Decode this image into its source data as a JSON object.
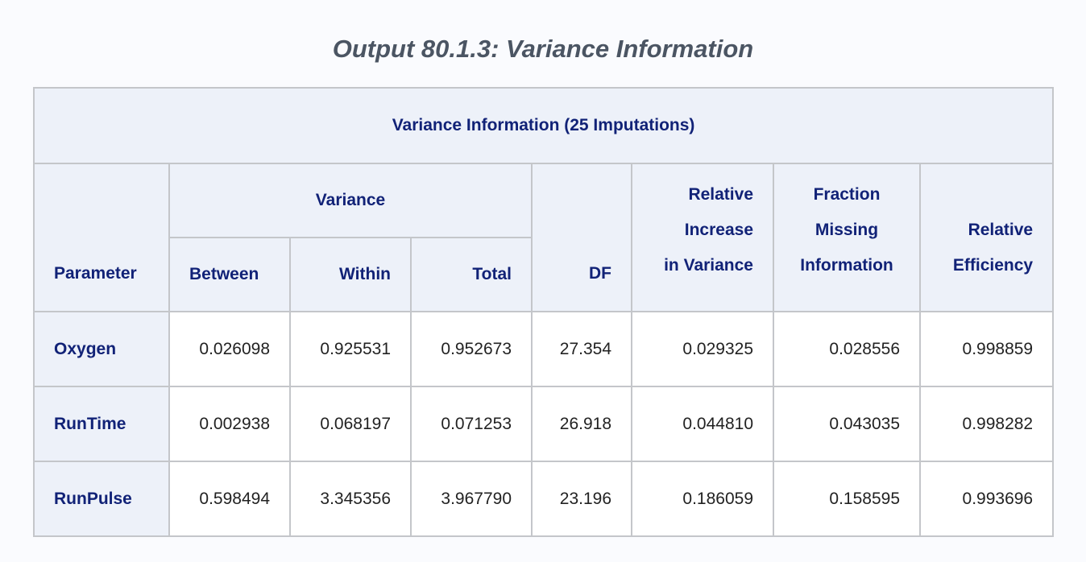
{
  "title": "Output 80.1.3: Variance Information",
  "table": {
    "caption": "Variance Information (25 Imputations)",
    "headers": {
      "parameter": "Parameter",
      "variance_group": "Variance",
      "between": "Between",
      "within": "Within",
      "total": "Total",
      "df": "DF",
      "relative_increase": [
        "Relative",
        "Increase",
        "in Variance"
      ],
      "fraction_missing": [
        "Fraction",
        "Missing",
        "Information"
      ],
      "relative_efficiency": [
        "Relative",
        "Efficiency"
      ]
    },
    "rows": [
      {
        "parameter": "Oxygen",
        "between": "0.026098",
        "within": "0.925531",
        "total": "0.952673",
        "df": "27.354",
        "relative_increase": "0.029325",
        "fraction_missing": "0.028556",
        "relative_efficiency": "0.998859"
      },
      {
        "parameter": "RunTime",
        "between": "0.002938",
        "within": "0.068197",
        "total": "0.071253",
        "df": "26.918",
        "relative_increase": "0.044810",
        "fraction_missing": "0.043035",
        "relative_efficiency": "0.998282"
      },
      {
        "parameter": "RunPulse",
        "between": "0.598494",
        "within": "3.345356",
        "total": "3.967790",
        "df": "23.196",
        "relative_increase": "0.186059",
        "fraction_missing": "0.158595",
        "relative_efficiency": "0.993696"
      }
    ]
  }
}
